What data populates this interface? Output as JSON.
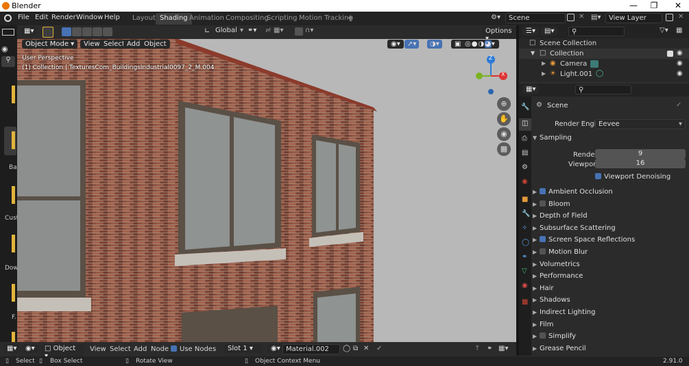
{
  "window": {
    "title": "Blender",
    "controls": [
      "—",
      "❐",
      "✕"
    ]
  },
  "topbar": {
    "menus": [
      "File",
      "Edit",
      "Render",
      "Window",
      "Help"
    ],
    "workspaces": [
      "Layout",
      "Shading",
      "Animation",
      "Compositing",
      "Scripting",
      "Motion Tracking"
    ],
    "active_workspace": "Shading",
    "add_tab": "+",
    "scene": "Scene",
    "view_layer": "View Layer"
  },
  "viewport": {
    "transform_orientation": "Global",
    "options_label": "Options",
    "mode": "Object Mode",
    "menus": [
      "View",
      "Select",
      "Add",
      "Object"
    ],
    "perspective_label": "User Perspective",
    "object_info": "(1) Collection | TexturesCom_BuildingsIndustrial0097_2_M.004",
    "gizmo": {
      "x": "X",
      "y": "Y",
      "z": "Z"
    }
  },
  "toolbar_labels": [
    "Ba",
    "Cust",
    "Dow",
    "F."
  ],
  "node_editor": {
    "type": "Object",
    "menus": [
      "View",
      "Select",
      "Add",
      "Node"
    ],
    "use_nodes_label": "Use Nodes",
    "use_nodes": true,
    "slot": "Slot 1",
    "material": "Material.002"
  },
  "statusbar": {
    "items": [
      "Select",
      "Box Select",
      "Rotate View",
      "Object Context Menu"
    ],
    "version": "2.91.0"
  },
  "outliner": {
    "items": [
      {
        "label": "Scene Collection",
        "indent": 0
      },
      {
        "label": "Collection",
        "indent": 1
      },
      {
        "label": "Camera",
        "indent": 2
      },
      {
        "label": "Light.001",
        "indent": 2
      }
    ]
  },
  "properties": {
    "context": "Scene",
    "render_engine_label": "Render Engine",
    "render_engine": "Eevee",
    "sampling_label": "Sampling",
    "render_label": "Render",
    "render_samples": 9,
    "viewport_label": "Viewport",
    "viewport_samples": 16,
    "viewport_denoising_label": "Viewport Denoising",
    "panels": [
      {
        "label": "Ambient Occlusion",
        "checkbox": true,
        "checked": true
      },
      {
        "label": "Bloom",
        "checkbox": true,
        "checked": false
      },
      {
        "label": "Depth of Field",
        "checkbox": false
      },
      {
        "label": "Subsurface Scattering",
        "checkbox": false
      },
      {
        "label": "Screen Space Reflections",
        "checkbox": true,
        "checked": true
      },
      {
        "label": "Motion Blur",
        "checkbox": true,
        "checked": false
      },
      {
        "label": "Volumetrics",
        "checkbox": false
      },
      {
        "label": "Performance",
        "checkbox": false
      },
      {
        "label": "Hair",
        "checkbox": false
      },
      {
        "label": "Shadows",
        "checkbox": false
      },
      {
        "label": "Indirect Lighting",
        "checkbox": false
      },
      {
        "label": "Film",
        "checkbox": false
      },
      {
        "label": "Simplify",
        "checkbox": true,
        "checked": false
      },
      {
        "label": "Grease Pencil",
        "checkbox": false
      }
    ]
  },
  "colors": {
    "accent": "#4772b3",
    "brand": "#ea7600",
    "brick": "#8a4f3e",
    "sky": "#b7b7b7"
  }
}
